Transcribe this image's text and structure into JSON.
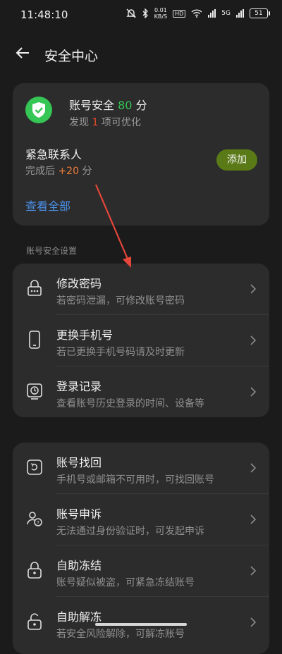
{
  "status": {
    "time": "11:48:10",
    "net_speed": "0.01",
    "net_unit": "KB/S",
    "hd": "HD",
    "network": "5G",
    "battery": "51"
  },
  "header": {
    "title": "安全中心"
  },
  "security": {
    "score_label": "账号安全",
    "score": "80",
    "score_unit": "分",
    "sub_prefix": "发现",
    "sub_count": "1",
    "sub_suffix": "项可优化",
    "contact_title": "紧急联系人",
    "contact_sub_prefix": "完成后",
    "contact_points": "+20",
    "contact_sub_suffix": "分",
    "add_label": "添加",
    "view_all": "查看全部"
  },
  "section_label": "账号安全设置",
  "settings": [
    {
      "title": "修改密码",
      "subtitle": "若密码泄漏，可修改账号密码",
      "icon": "password-icon"
    },
    {
      "title": "更换手机号",
      "subtitle": "若已更换手机号码请及时更新",
      "icon": "phone-icon"
    },
    {
      "title": "登录记录",
      "subtitle": "查看账号历史登录的时间、设备等",
      "icon": "clock-icon"
    }
  ],
  "recovery": [
    {
      "title": "账号找回",
      "subtitle": "手机号或邮箱不可用时，可找回账号",
      "icon": "retrieve-icon"
    },
    {
      "title": "账号申诉",
      "subtitle": "无法通过身份验证时，可发起申诉",
      "icon": "appeal-icon"
    },
    {
      "title": "自助冻结",
      "subtitle": "账号疑似被盗，可紧急冻结账号",
      "icon": "lock-icon"
    },
    {
      "title": "自助解冻",
      "subtitle": "若安全风险解除，可解冻账号",
      "icon": "unlock-icon"
    }
  ],
  "colors": {
    "accent_green": "#35c655",
    "warn_red": "#ee4a2b",
    "points_orange": "#f07d3a",
    "link_blue": "#4a90e8",
    "annotation_arrow": "#e5473a"
  }
}
